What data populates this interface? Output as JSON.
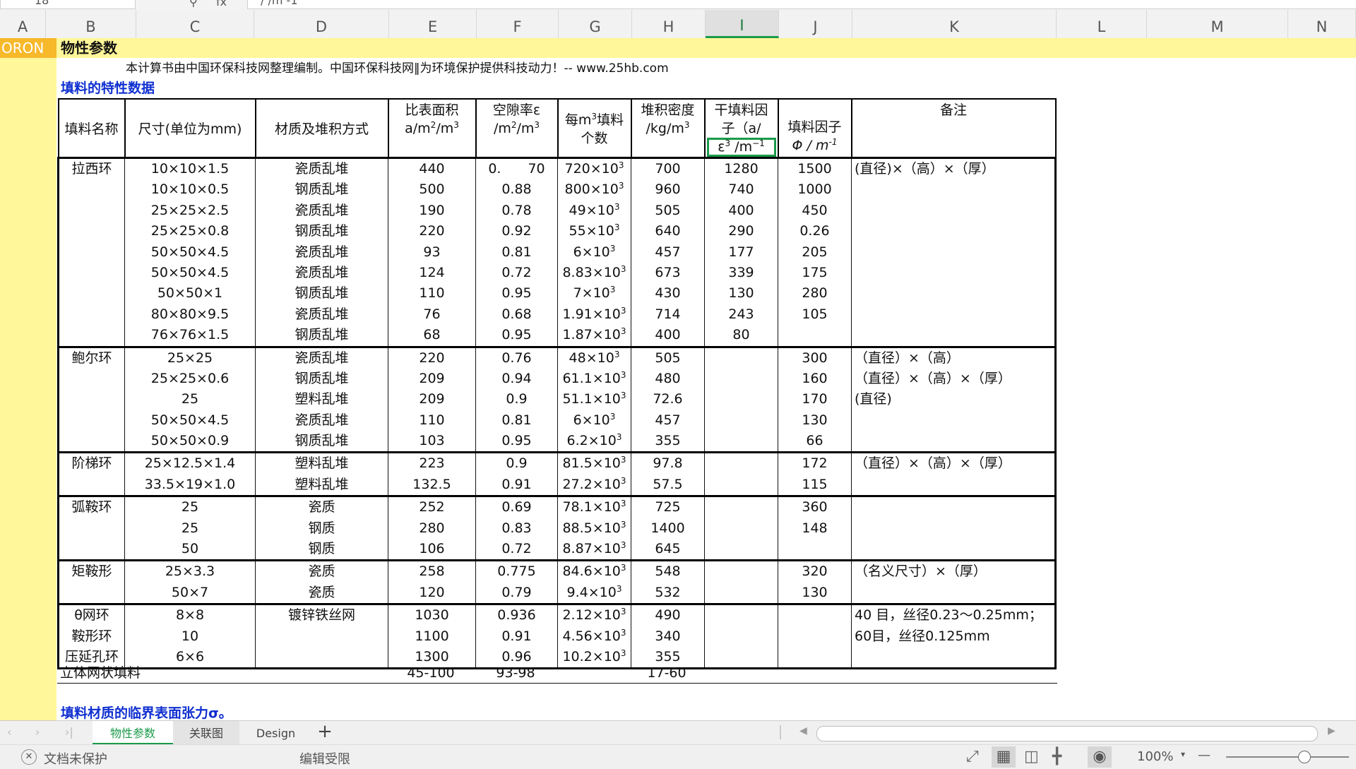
{
  "formula_bar": {
    "cell_fragment": "18",
    "fx_label": "fx",
    "formula_fragment": "/ /m -1"
  },
  "columns": [
    "A",
    "B",
    "C",
    "D",
    "E",
    "F",
    "G",
    "H",
    "I",
    "J",
    "K",
    "L",
    "M",
    "N"
  ],
  "sheet": {
    "corner_label": "ORON",
    "title": "物性参数",
    "credit": "本计算书由中国环保科技网整理编制。中国环保科技网‖为环境保护提供科技动力！-- www.25hb.com",
    "section_title": "填料的特性数据",
    "bottom_section_title": "填料材质的临界表面张力σ。"
  },
  "table": {
    "headers": {
      "name": "填料名称",
      "size": "尺寸(单位为mm)",
      "material": "材质及堆积方式",
      "area_l1": "比表面积",
      "area_l2": "a/m",
      "area_l2b": "/m",
      "void_l1": "空隙率ε",
      "void_l2": "/m",
      "void_l2b": "/m",
      "count_l1a": "每m",
      "count_l1b": "填料",
      "count_l2": "个数",
      "density_l1": "堆积密度",
      "density_l2": "/kg/m",
      "dry_l1": "干填料因",
      "dry_l2": "子（a/",
      "dry_l3a": "ε",
      "dry_l3b": " /m",
      "factor_l1": "填料因子",
      "factor_l2": "Φ / m",
      "remark": "备注",
      "sup2": "2",
      "sup3": "3",
      "supm1": "−1",
      "supm1b": "-1"
    },
    "exp_sup": "3",
    "groups": [
      {
        "name": [
          "拉西环"
        ],
        "rows": [
          {
            "size": "10×10×1.5",
            "mat": "瓷质乱堆",
            "area": "440",
            "void": "0.　　70",
            "cnt": "720×10",
            "dens": "700",
            "dry": "1280",
            "fac": "1500",
            "note": "(直径)×（高）×（厚）"
          },
          {
            "size": "10×10×0.5",
            "mat": "钢质乱堆",
            "area": "500",
            "void": "0.88",
            "cnt": "800×10",
            "dens": "960",
            "dry": "740",
            "fac": "1000",
            "note": ""
          },
          {
            "size": "25×25×2.5",
            "mat": "瓷质乱堆",
            "area": "190",
            "void": "0.78",
            "cnt": "49×10",
            "dens": "505",
            "dry": "400",
            "fac": "450",
            "note": ""
          },
          {
            "size": "25×25×0.8",
            "mat": "钢质乱堆",
            "area": "220",
            "void": "0.92",
            "cnt": "55×10",
            "dens": "640",
            "dry": "290",
            "fac": "0.26",
            "note": ""
          },
          {
            "size": "50×50×4.5",
            "mat": "瓷质乱堆",
            "area": "93",
            "void": "0.81",
            "cnt": "6×10",
            "dens": "457",
            "dry": "177",
            "fac": "205",
            "note": ""
          },
          {
            "size": "50×50×4.5",
            "mat": "瓷质乱堆",
            "area": "124",
            "void": "0.72",
            "cnt": "8.83×10",
            "dens": "673",
            "dry": "339",
            "fac": "175",
            "note": ""
          },
          {
            "size": "50×50×1",
            "mat": "钢质乱堆",
            "area": "110",
            "void": "0.95",
            "cnt": "7×10",
            "dens": "430",
            "dry": "130",
            "fac": "280",
            "note": ""
          },
          {
            "size": "80×80×9.5",
            "mat": "瓷质乱堆",
            "area": "76",
            "void": "0.68",
            "cnt": "1.91×10",
            "dens": "714",
            "dry": "243",
            "fac": "105",
            "note": ""
          },
          {
            "size": "76×76×1.5",
            "mat": "钢质乱堆",
            "area": "68",
            "void": "0.95",
            "cnt": "1.87×10",
            "dens": "400",
            "dry": "80",
            "fac": "",
            "note": ""
          }
        ]
      },
      {
        "name": [
          "鲍尔环"
        ],
        "rows": [
          {
            "size": "25×25",
            "mat": "瓷质乱堆",
            "area": "220",
            "void": "0.76",
            "cnt": "48×10",
            "dens": "505",
            "dry": "",
            "fac": "300",
            "note": "（直径）×（高）"
          },
          {
            "size": "25×25×0.6",
            "mat": "钢质乱堆",
            "area": "209",
            "void": "0.94",
            "cnt": "61.1×10",
            "dens": "480",
            "dry": "",
            "fac": "160",
            "note": "（直径）×（高）×（厚）"
          },
          {
            "size": "25",
            "mat": "塑料乱堆",
            "area": "209",
            "void": "0.9",
            "cnt": "51.1×10",
            "dens": "72.6",
            "dry": "",
            "fac": "170",
            "note": "(直径)"
          },
          {
            "size": "50×50×4.5",
            "mat": "瓷质乱堆",
            "area": "110",
            "void": "0.81",
            "cnt": "6×10",
            "dens": "457",
            "dry": "",
            "fac": "130",
            "note": ""
          },
          {
            "size": "50×50×0.9",
            "mat": "钢质乱堆",
            "area": "103",
            "void": "0.95",
            "cnt": "6.2×10",
            "dens": "355",
            "dry": "",
            "fac": "66",
            "note": ""
          }
        ]
      },
      {
        "name": [
          "阶梯环"
        ],
        "rows": [
          {
            "size": "25×12.5×1.4",
            "mat": "塑料乱堆",
            "area": "223",
            "void": "0.9",
            "cnt": "81.5×10",
            "dens": "97.8",
            "dry": "",
            "fac": "172",
            "note": "（直径）×（高）×（厚）"
          },
          {
            "size": "33.5×19×1.0",
            "mat": "塑料乱堆",
            "area": "132.5",
            "void": "0.91",
            "cnt": "27.2×10",
            "dens": "57.5",
            "dry": "",
            "fac": "115",
            "note": ""
          }
        ]
      },
      {
        "name": [
          "弧鞍环"
        ],
        "rows": [
          {
            "size": "25",
            "mat": "瓷质",
            "area": "252",
            "void": "0.69",
            "cnt": "78.1×10",
            "dens": "725",
            "dry": "",
            "fac": "360",
            "note": ""
          },
          {
            "size": "25",
            "mat": "钢质",
            "area": "280",
            "void": "0.83",
            "cnt": "88.5×10",
            "dens": "1400",
            "dry": "",
            "fac": "148",
            "note": ""
          },
          {
            "size": "50",
            "mat": "钢质",
            "area": "106",
            "void": "0.72",
            "cnt": "8.87×10",
            "dens": "645",
            "dry": "",
            "fac": "",
            "note": ""
          }
        ]
      },
      {
        "name": [
          "矩鞍形"
        ],
        "rows": [
          {
            "size": "25×3.3",
            "mat": "瓷质",
            "area": "258",
            "void": "0.775",
            "cnt": "84.6×10",
            "dens": "548",
            "dry": "",
            "fac": "320",
            "note": "（名义尺寸）×（厚）"
          },
          {
            "size": "50×7",
            "mat": "瓷质",
            "area": "120",
            "void": "0.79",
            "cnt": "9.4×10",
            "dens": "532",
            "dry": "",
            "fac": "130",
            "note": ""
          }
        ]
      },
      {
        "name": [
          "θ网环",
          "鞍形环",
          "压延孔环"
        ],
        "rows": [
          {
            "size": "8×8",
            "mat": "镀锌铁丝网",
            "area": "1030",
            "void": "0.936",
            "cnt": "2.12×10",
            "dens": "490",
            "dry": "",
            "fac": "",
            "note": "40 目，丝径0.23～0.25mm；"
          },
          {
            "size": "10",
            "mat": "",
            "area": "1100",
            "void": "0.91",
            "cnt": "4.56×10",
            "dens": "340",
            "dry": "",
            "fac": "",
            "note": "60目，丝径0.125mm"
          },
          {
            "size": "6×6",
            "mat": "",
            "area": "1300",
            "void": "0.96",
            "cnt": "10.2×10",
            "dens": "355",
            "dry": "",
            "fac": "",
            "note": ""
          }
        ]
      }
    ],
    "footer_row": {
      "name": "立体网状填料",
      "area": "45-100",
      "void": "93-98",
      "dens": "17-60"
    }
  },
  "sheet_tabs": [
    "物性参数",
    "关联图",
    "Design"
  ],
  "active_tab": "物性参数",
  "add_tab_symbol": "+",
  "status_bar": {
    "protect_label": "文档未保护",
    "edit_label": "编辑受限",
    "zoom": "100%",
    "zoom_minus": "—"
  },
  "colors": {
    "row_highlight": "#fff799",
    "corner_orange": "#f7b82a",
    "accent_green": "#1a9a4a",
    "title_blue": "#0f2fd0"
  }
}
